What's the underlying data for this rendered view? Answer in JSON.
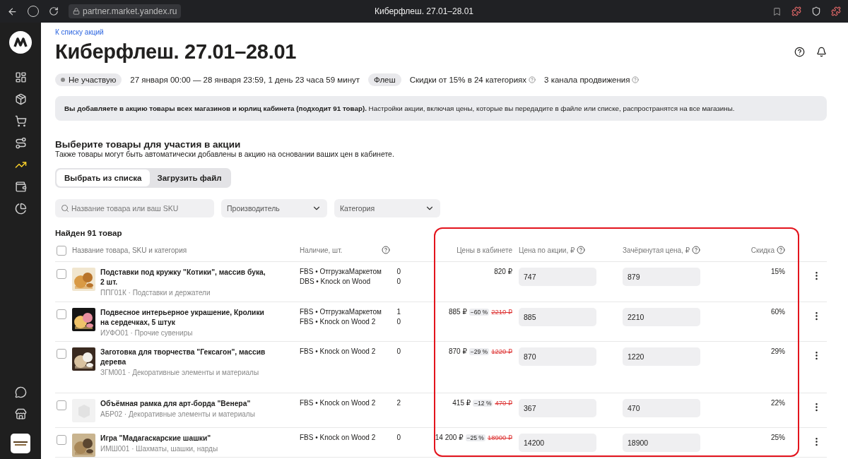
{
  "browser": {
    "url": "partner.market.yandex.ru",
    "title": "Киберфлеш. 27.01–28.01"
  },
  "sidebar": {
    "items": [
      {
        "selected": false
      },
      {
        "selected": false
      },
      {
        "selected": false
      },
      {
        "selected": false
      },
      {
        "selected": true
      },
      {
        "selected": false
      },
      {
        "selected": false
      }
    ],
    "bottom_items": [
      {
        "selected": false
      },
      {
        "selected": false
      }
    ]
  },
  "back_link": "К списку акций",
  "title": "Киберфлеш. 27.01–28.01",
  "status": {
    "participation": "Не участвую",
    "period": "27 января 00:00 — 28 января 23:59, 1 день 23 часа 59 минут",
    "type": "Флеш",
    "discounts": "Скидки от 15% в 24 категориях",
    "channels": "3 канала продвижения"
  },
  "banner": "**Вы добавляете в акцию товары всех магазинов и юрлиц кабинета (подходит 91 товар).** Настройки акции, включая цены, которые вы передадите в файле или списке, распространятся на все магазины.",
  "section": {
    "title": "Выберите товары для участия в акции",
    "subtitle": "Также товары могут быть автоматически добавлены в акцию на основании ваших цен в кабинете."
  },
  "tabs": [
    {
      "label": "Выбрать из списка",
      "selected": true
    },
    {
      "label": "Загрузить файл",
      "selected": false
    }
  ],
  "filters": {
    "search": {
      "placeholder": "Название товара или ваш SKU"
    },
    "dropdowns": [
      {
        "placeholder": "Производитель"
      },
      {
        "placeholder": "Категория"
      }
    ]
  },
  "found": "Найден 91 товар",
  "table": {
    "select_all_checked": false,
    "columns": [
      "Название товара, SKU и категория",
      "Наличие, шт.",
      "Цены в кабинете",
      "Цена по акции, ₽",
      "Зачёркнутая цена, ₽",
      "Скидка"
    ],
    "rows": [
      {
        "checked": false,
        "kind": "picture",
        "name": "Подставки под кружку \"Котики\", массив бука, 2 шт.",
        "sku_category": "ППГ01К · Подставки и держатели",
        "stock": [
          {
            "store": "FBS • ОтгрузкаМаркетом",
            "count": "0"
          },
          {
            "store": "DBS • Knock on Wood",
            "count": "0"
          }
        ],
        "cabinet": {
          "price": "820 ₽"
        },
        "promo_price": "747",
        "struck_price": "879",
        "discount": "15%"
      },
      {
        "checked": false,
        "kind": "picture",
        "name": "Подвесное интерьерное украшение, Кролики на сердечках, 5 штук",
        "sku_category": "ИУФО01 · Прочие сувениры",
        "stock": [
          {
            "store": "FBS • ОтгрузкаМаркетом",
            "count": "1"
          },
          {
            "store": "FBS • Knock on Wood 2",
            "count": "0"
          }
        ],
        "cabinet": {
          "price": "885 ₽",
          "discount": "−60 %",
          "old": "2210 ₽"
        },
        "promo_price": "885",
        "struck_price": "2210",
        "discount": "60%"
      },
      {
        "checked": false,
        "kind": "picture",
        "name": "Заготовка для творчества \"Гексагон\", массив дерева",
        "sku_category": "ЗГМ001 · Декоративные элементы и материалы",
        "stock": [
          {
            "store": "FBS • Knock on Wood 2",
            "count": "0"
          }
        ],
        "cabinet": {
          "price": "870 ₽",
          "discount": "−29 %",
          "old": "1220 ₽"
        },
        "promo_price": "870",
        "struck_price": "1220",
        "discount": "29%"
      },
      {
        "checked": false,
        "kind": "placeholder",
        "name": "Объёмная рамка для арт-борда \"Венера\"",
        "sku_category": "АБР02 · Декоративные элементы и материалы",
        "stock": [
          {
            "store": "FBS • Knock on Wood 2",
            "count": "2"
          }
        ],
        "cabinet": {
          "price": "415 ₽",
          "discount": "−12 %",
          "old": "470 ₽"
        },
        "promo_price": "367",
        "struck_price": "470",
        "discount": "22%"
      },
      {
        "checked": false,
        "kind": "picture",
        "name": "Игра \"Мадагаскарские шашки\"",
        "sku_category": "ИМШ001 · Шахматы, шашки, нарды",
        "stock": [
          {
            "store": "FBS • Knock on Wood 2",
            "count": "0"
          }
        ],
        "cabinet": {
          "price": "14 200 ₽",
          "discount": "−25 %",
          "old": "18900 ₽"
        },
        "promo_price": "14200",
        "struck_price": "18900",
        "discount": "25%"
      }
    ]
  },
  "highlight": {
    "visible": true
  }
}
